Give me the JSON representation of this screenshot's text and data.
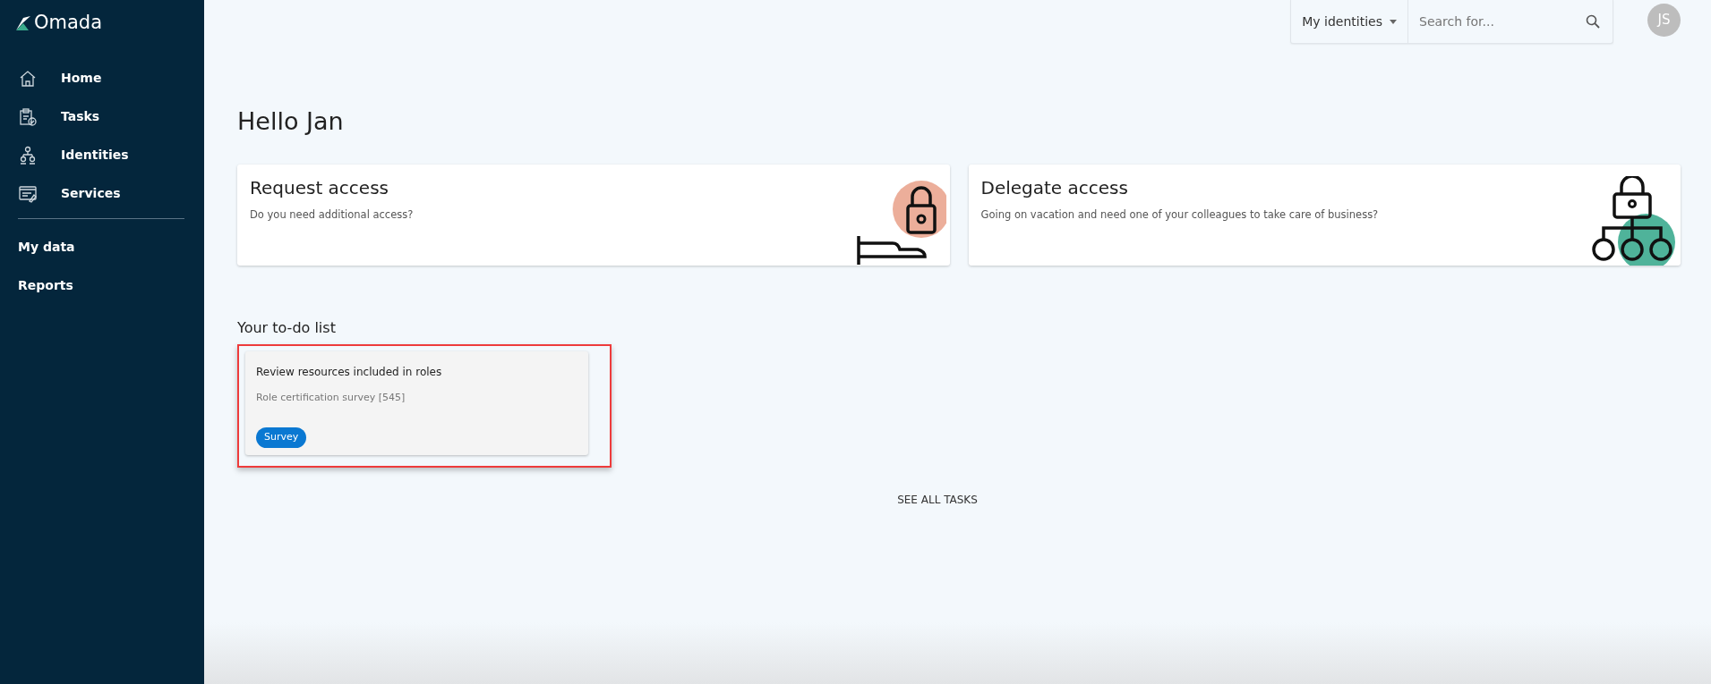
{
  "sidebar": {
    "logo": "Omada",
    "items": [
      {
        "label": "Home"
      },
      {
        "label": "Tasks"
      },
      {
        "label": "Identities"
      },
      {
        "label": "Services"
      }
    ],
    "secondary_items": [
      {
        "label": "My data"
      },
      {
        "label": "Reports"
      }
    ]
  },
  "topbar": {
    "scope": "My identities",
    "search": {
      "placeholder": "Search for..."
    },
    "avatar": "JS"
  },
  "greeting": "Hello Jan",
  "action_cards": [
    {
      "title": "Request access",
      "description": "Do you need additional access?"
    },
    {
      "title": "Delegate access",
      "description": "Going on vacation and need one of your colleagues to take care of business?"
    }
  ],
  "todo": {
    "heading": "Your to-do list",
    "items": [
      {
        "title": "Review resources included in roles",
        "subtitle": "Role certification survey [545]",
        "tag": "Survey",
        "highlighted": true
      }
    ],
    "see_all": "SEE ALL TASKS"
  }
}
